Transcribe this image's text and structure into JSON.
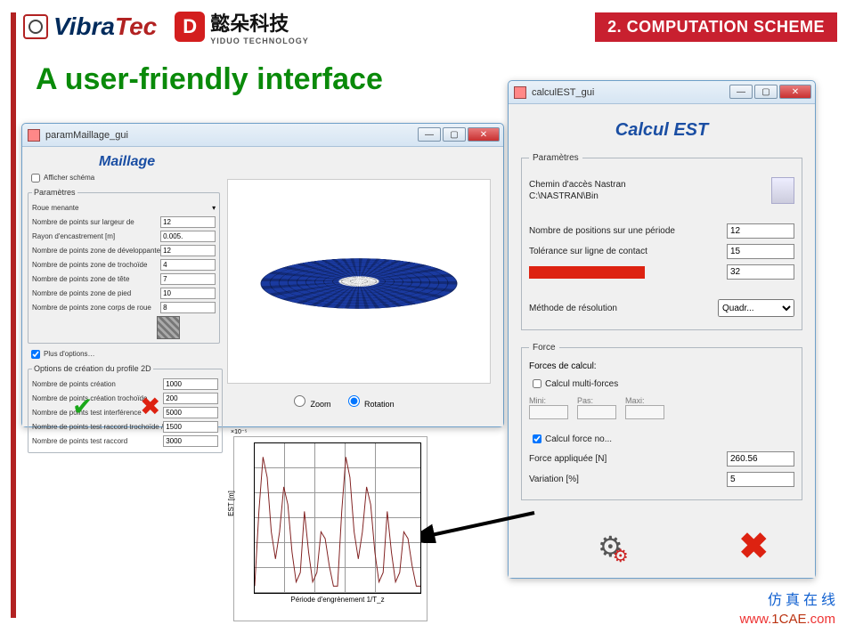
{
  "header": {
    "brand1a": "Vibra",
    "brand1b": "Tec",
    "brand2_cn": "懿朵科技",
    "brand2_en": "YIDUO TECHNOLOGY",
    "banner": "2. COMPUTATION SCHEME"
  },
  "page_title": "A user-friendly interface",
  "win1": {
    "title": "paramMaillage_gui",
    "section": "Maillage",
    "afficher": "Afficher schéma",
    "group_params": "Paramètres",
    "roue_label": "Roue menante",
    "params": [
      {
        "label": "Nombre de points sur largeur de",
        "value": "12"
      },
      {
        "label": "Rayon d'encastrement [m]",
        "value": "0.005."
      },
      {
        "label": "Nombre de points zone de développante",
        "value": "12"
      },
      {
        "label": "Nombre de points zone de trochoïde",
        "value": "4"
      },
      {
        "label": "Nombre de points zone de tête",
        "value": "7"
      },
      {
        "label": "Nombre de points zone de pied",
        "value": "10"
      },
      {
        "label": "Nombre de points zone corps de roue",
        "value": "8"
      }
    ],
    "plus_options": "Plus d'options…",
    "group_opts": "Options de création du profile 2D",
    "opts": [
      {
        "label": "Nombre de points création",
        "value": "1000"
      },
      {
        "label": "Nombre de points création trochoïde",
        "value": "200"
      },
      {
        "label": "Nombre de points test interférence",
        "value": "5000"
      },
      {
        "label": "Nombre de points test raccord trochoïde /",
        "value": "1500"
      },
      {
        "label": "Nombre de points test raccord",
        "value": "3000"
      }
    ],
    "radio_zoom": "Zoom",
    "radio_rotation": "Rotation"
  },
  "win2": {
    "title": "calculEST_gui",
    "section": "Calcul EST",
    "group_params": "Paramètres",
    "nastran_label": "Chemin d'accès Nastran",
    "nastran_path": "C:\\NASTRAN\\Bin",
    "p1_label": "Nombre de positions sur une période",
    "p1_value": "12",
    "p2_label": "Tolérance sur ligne de contact",
    "p2_value": "15",
    "p3_value": "32",
    "method_label": "Méthode de résolution",
    "method_value": "Quadr...",
    "group_force": "Force",
    "forces_label": "Forces de calcul:",
    "multi_label": "Calcul multi-forces",
    "mini": "Mini:",
    "pas": "Pas:",
    "maxi": "Maxi:",
    "nominal_label": "Calcul force no...",
    "force_app_label": "Force appliquée [N]",
    "force_app_value": "260.56",
    "variation_label": "Variation [%]",
    "variation_value": "5"
  },
  "chart_data": {
    "type": "line",
    "title": "",
    "xlabel": "Période d'engrènement 1/T_z",
    "ylabel": "EST [m]",
    "y_scale": "×10⁻⁵",
    "ylim": [
      4.1,
      5.2
    ],
    "xlim": [
      0,
      2
    ],
    "x": [
      0,
      0.05,
      0.1,
      0.15,
      0.2,
      0.25,
      0.3,
      0.35,
      0.4,
      0.45,
      0.5,
      0.55,
      0.6,
      0.65,
      0.7,
      0.75,
      0.8,
      0.85,
      0.9,
      0.95,
      1.0,
      1.05,
      1.1,
      1.15,
      1.2,
      1.25,
      1.3,
      1.35,
      1.4,
      1.45,
      1.5,
      1.55,
      1.6,
      1.65,
      1.7,
      1.75,
      1.8,
      1.85,
      1.9,
      1.95,
      2.0
    ],
    "y": [
      4.15,
      4.7,
      5.1,
      4.95,
      4.55,
      4.35,
      4.55,
      4.88,
      4.75,
      4.4,
      4.18,
      4.25,
      4.7,
      4.4,
      4.18,
      4.25,
      4.55,
      4.5,
      4.3,
      4.15,
      4.15,
      4.7,
      5.1,
      4.95,
      4.55,
      4.35,
      4.55,
      4.88,
      4.75,
      4.4,
      4.18,
      4.25,
      4.7,
      4.4,
      4.18,
      4.25,
      4.55,
      4.5,
      4.3,
      4.15,
      4.15
    ]
  },
  "footer": {
    "cn": "仿 真 在 线",
    "url_w": "www.",
    "url_d": "1CAE",
    "url_tail": ".com"
  }
}
